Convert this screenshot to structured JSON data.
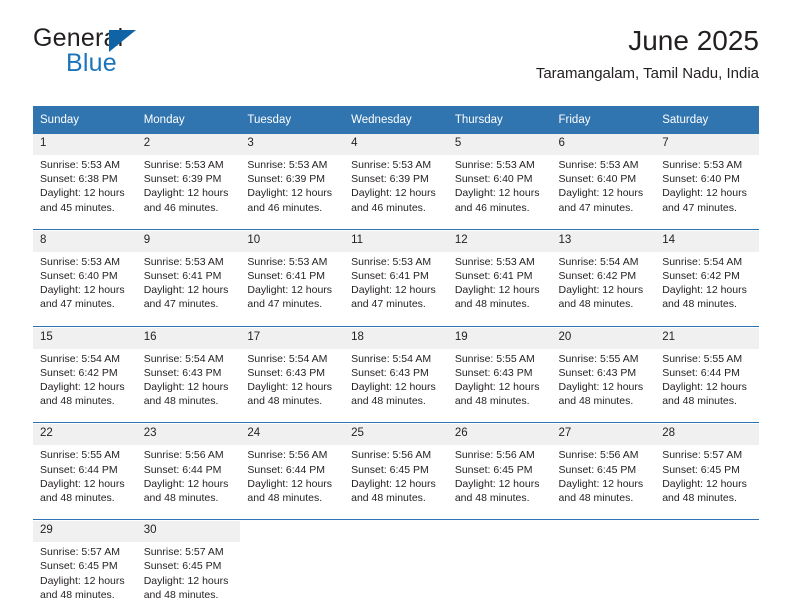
{
  "logo": {
    "text_primary": "General",
    "text_secondary": "Blue",
    "triangle_color": "#1064a6",
    "secondary_color": "#1b75bc"
  },
  "header": {
    "title": "June 2025",
    "subtitle": "Taramangalam, Tamil Nadu, India"
  },
  "theme": {
    "header_blue": "#3074b0",
    "separator_blue": "#2e74b5",
    "daynum_band": "#f0f0f0",
    "text": "#231f20"
  },
  "calendar": {
    "weekday_headers": [
      "Sunday",
      "Monday",
      "Tuesday",
      "Wednesday",
      "Thursday",
      "Friday",
      "Saturday"
    ],
    "weeks": [
      [
        {
          "day": "1",
          "sunrise": "Sunrise: 5:53 AM",
          "sunset": "Sunset: 6:38 PM",
          "daylight_1": "Daylight: 12 hours",
          "daylight_2": "and 45 minutes."
        },
        {
          "day": "2",
          "sunrise": "Sunrise: 5:53 AM",
          "sunset": "Sunset: 6:39 PM",
          "daylight_1": "Daylight: 12 hours",
          "daylight_2": "and 46 minutes."
        },
        {
          "day": "3",
          "sunrise": "Sunrise: 5:53 AM",
          "sunset": "Sunset: 6:39 PM",
          "daylight_1": "Daylight: 12 hours",
          "daylight_2": "and 46 minutes."
        },
        {
          "day": "4",
          "sunrise": "Sunrise: 5:53 AM",
          "sunset": "Sunset: 6:39 PM",
          "daylight_1": "Daylight: 12 hours",
          "daylight_2": "and 46 minutes."
        },
        {
          "day": "5",
          "sunrise": "Sunrise: 5:53 AM",
          "sunset": "Sunset: 6:40 PM",
          "daylight_1": "Daylight: 12 hours",
          "daylight_2": "and 46 minutes."
        },
        {
          "day": "6",
          "sunrise": "Sunrise: 5:53 AM",
          "sunset": "Sunset: 6:40 PM",
          "daylight_1": "Daylight: 12 hours",
          "daylight_2": "and 47 minutes."
        },
        {
          "day": "7",
          "sunrise": "Sunrise: 5:53 AM",
          "sunset": "Sunset: 6:40 PM",
          "daylight_1": "Daylight: 12 hours",
          "daylight_2": "and 47 minutes."
        }
      ],
      [
        {
          "day": "8",
          "sunrise": "Sunrise: 5:53 AM",
          "sunset": "Sunset: 6:40 PM",
          "daylight_1": "Daylight: 12 hours",
          "daylight_2": "and 47 minutes."
        },
        {
          "day": "9",
          "sunrise": "Sunrise: 5:53 AM",
          "sunset": "Sunset: 6:41 PM",
          "daylight_1": "Daylight: 12 hours",
          "daylight_2": "and 47 minutes."
        },
        {
          "day": "10",
          "sunrise": "Sunrise: 5:53 AM",
          "sunset": "Sunset: 6:41 PM",
          "daylight_1": "Daylight: 12 hours",
          "daylight_2": "and 47 minutes."
        },
        {
          "day": "11",
          "sunrise": "Sunrise: 5:53 AM",
          "sunset": "Sunset: 6:41 PM",
          "daylight_1": "Daylight: 12 hours",
          "daylight_2": "and 47 minutes."
        },
        {
          "day": "12",
          "sunrise": "Sunrise: 5:53 AM",
          "sunset": "Sunset: 6:41 PM",
          "daylight_1": "Daylight: 12 hours",
          "daylight_2": "and 48 minutes."
        },
        {
          "day": "13",
          "sunrise": "Sunrise: 5:54 AM",
          "sunset": "Sunset: 6:42 PM",
          "daylight_1": "Daylight: 12 hours",
          "daylight_2": "and 48 minutes."
        },
        {
          "day": "14",
          "sunrise": "Sunrise: 5:54 AM",
          "sunset": "Sunset: 6:42 PM",
          "daylight_1": "Daylight: 12 hours",
          "daylight_2": "and 48 minutes."
        }
      ],
      [
        {
          "day": "15",
          "sunrise": "Sunrise: 5:54 AM",
          "sunset": "Sunset: 6:42 PM",
          "daylight_1": "Daylight: 12 hours",
          "daylight_2": "and 48 minutes."
        },
        {
          "day": "16",
          "sunrise": "Sunrise: 5:54 AM",
          "sunset": "Sunset: 6:43 PM",
          "daylight_1": "Daylight: 12 hours",
          "daylight_2": "and 48 minutes."
        },
        {
          "day": "17",
          "sunrise": "Sunrise: 5:54 AM",
          "sunset": "Sunset: 6:43 PM",
          "daylight_1": "Daylight: 12 hours",
          "daylight_2": "and 48 minutes."
        },
        {
          "day": "18",
          "sunrise": "Sunrise: 5:54 AM",
          "sunset": "Sunset: 6:43 PM",
          "daylight_1": "Daylight: 12 hours",
          "daylight_2": "and 48 minutes."
        },
        {
          "day": "19",
          "sunrise": "Sunrise: 5:55 AM",
          "sunset": "Sunset: 6:43 PM",
          "daylight_1": "Daylight: 12 hours",
          "daylight_2": "and 48 minutes."
        },
        {
          "day": "20",
          "sunrise": "Sunrise: 5:55 AM",
          "sunset": "Sunset: 6:43 PM",
          "daylight_1": "Daylight: 12 hours",
          "daylight_2": "and 48 minutes."
        },
        {
          "day": "21",
          "sunrise": "Sunrise: 5:55 AM",
          "sunset": "Sunset: 6:44 PM",
          "daylight_1": "Daylight: 12 hours",
          "daylight_2": "and 48 minutes."
        }
      ],
      [
        {
          "day": "22",
          "sunrise": "Sunrise: 5:55 AM",
          "sunset": "Sunset: 6:44 PM",
          "daylight_1": "Daylight: 12 hours",
          "daylight_2": "and 48 minutes."
        },
        {
          "day": "23",
          "sunrise": "Sunrise: 5:56 AM",
          "sunset": "Sunset: 6:44 PM",
          "daylight_1": "Daylight: 12 hours",
          "daylight_2": "and 48 minutes."
        },
        {
          "day": "24",
          "sunrise": "Sunrise: 5:56 AM",
          "sunset": "Sunset: 6:44 PM",
          "daylight_1": "Daylight: 12 hours",
          "daylight_2": "and 48 minutes."
        },
        {
          "day": "25",
          "sunrise": "Sunrise: 5:56 AM",
          "sunset": "Sunset: 6:45 PM",
          "daylight_1": "Daylight: 12 hours",
          "daylight_2": "and 48 minutes."
        },
        {
          "day": "26",
          "sunrise": "Sunrise: 5:56 AM",
          "sunset": "Sunset: 6:45 PM",
          "daylight_1": "Daylight: 12 hours",
          "daylight_2": "and 48 minutes."
        },
        {
          "day": "27",
          "sunrise": "Sunrise: 5:56 AM",
          "sunset": "Sunset: 6:45 PM",
          "daylight_1": "Daylight: 12 hours",
          "daylight_2": "and 48 minutes."
        },
        {
          "day": "28",
          "sunrise": "Sunrise: 5:57 AM",
          "sunset": "Sunset: 6:45 PM",
          "daylight_1": "Daylight: 12 hours",
          "daylight_2": "and 48 minutes."
        }
      ],
      [
        {
          "day": "29",
          "sunrise": "Sunrise: 5:57 AM",
          "sunset": "Sunset: 6:45 PM",
          "daylight_1": "Daylight: 12 hours",
          "daylight_2": "and 48 minutes."
        },
        {
          "day": "30",
          "sunrise": "Sunrise: 5:57 AM",
          "sunset": "Sunset: 6:45 PM",
          "daylight_1": "Daylight: 12 hours",
          "daylight_2": "and 48 minutes."
        },
        {
          "day": "",
          "sunrise": "",
          "sunset": "",
          "daylight_1": "",
          "daylight_2": ""
        },
        {
          "day": "",
          "sunrise": "",
          "sunset": "",
          "daylight_1": "",
          "daylight_2": ""
        },
        {
          "day": "",
          "sunrise": "",
          "sunset": "",
          "daylight_1": "",
          "daylight_2": ""
        },
        {
          "day": "",
          "sunrise": "",
          "sunset": "",
          "daylight_1": "",
          "daylight_2": ""
        },
        {
          "day": "",
          "sunrise": "",
          "sunset": "",
          "daylight_1": "",
          "daylight_2": ""
        }
      ]
    ]
  }
}
